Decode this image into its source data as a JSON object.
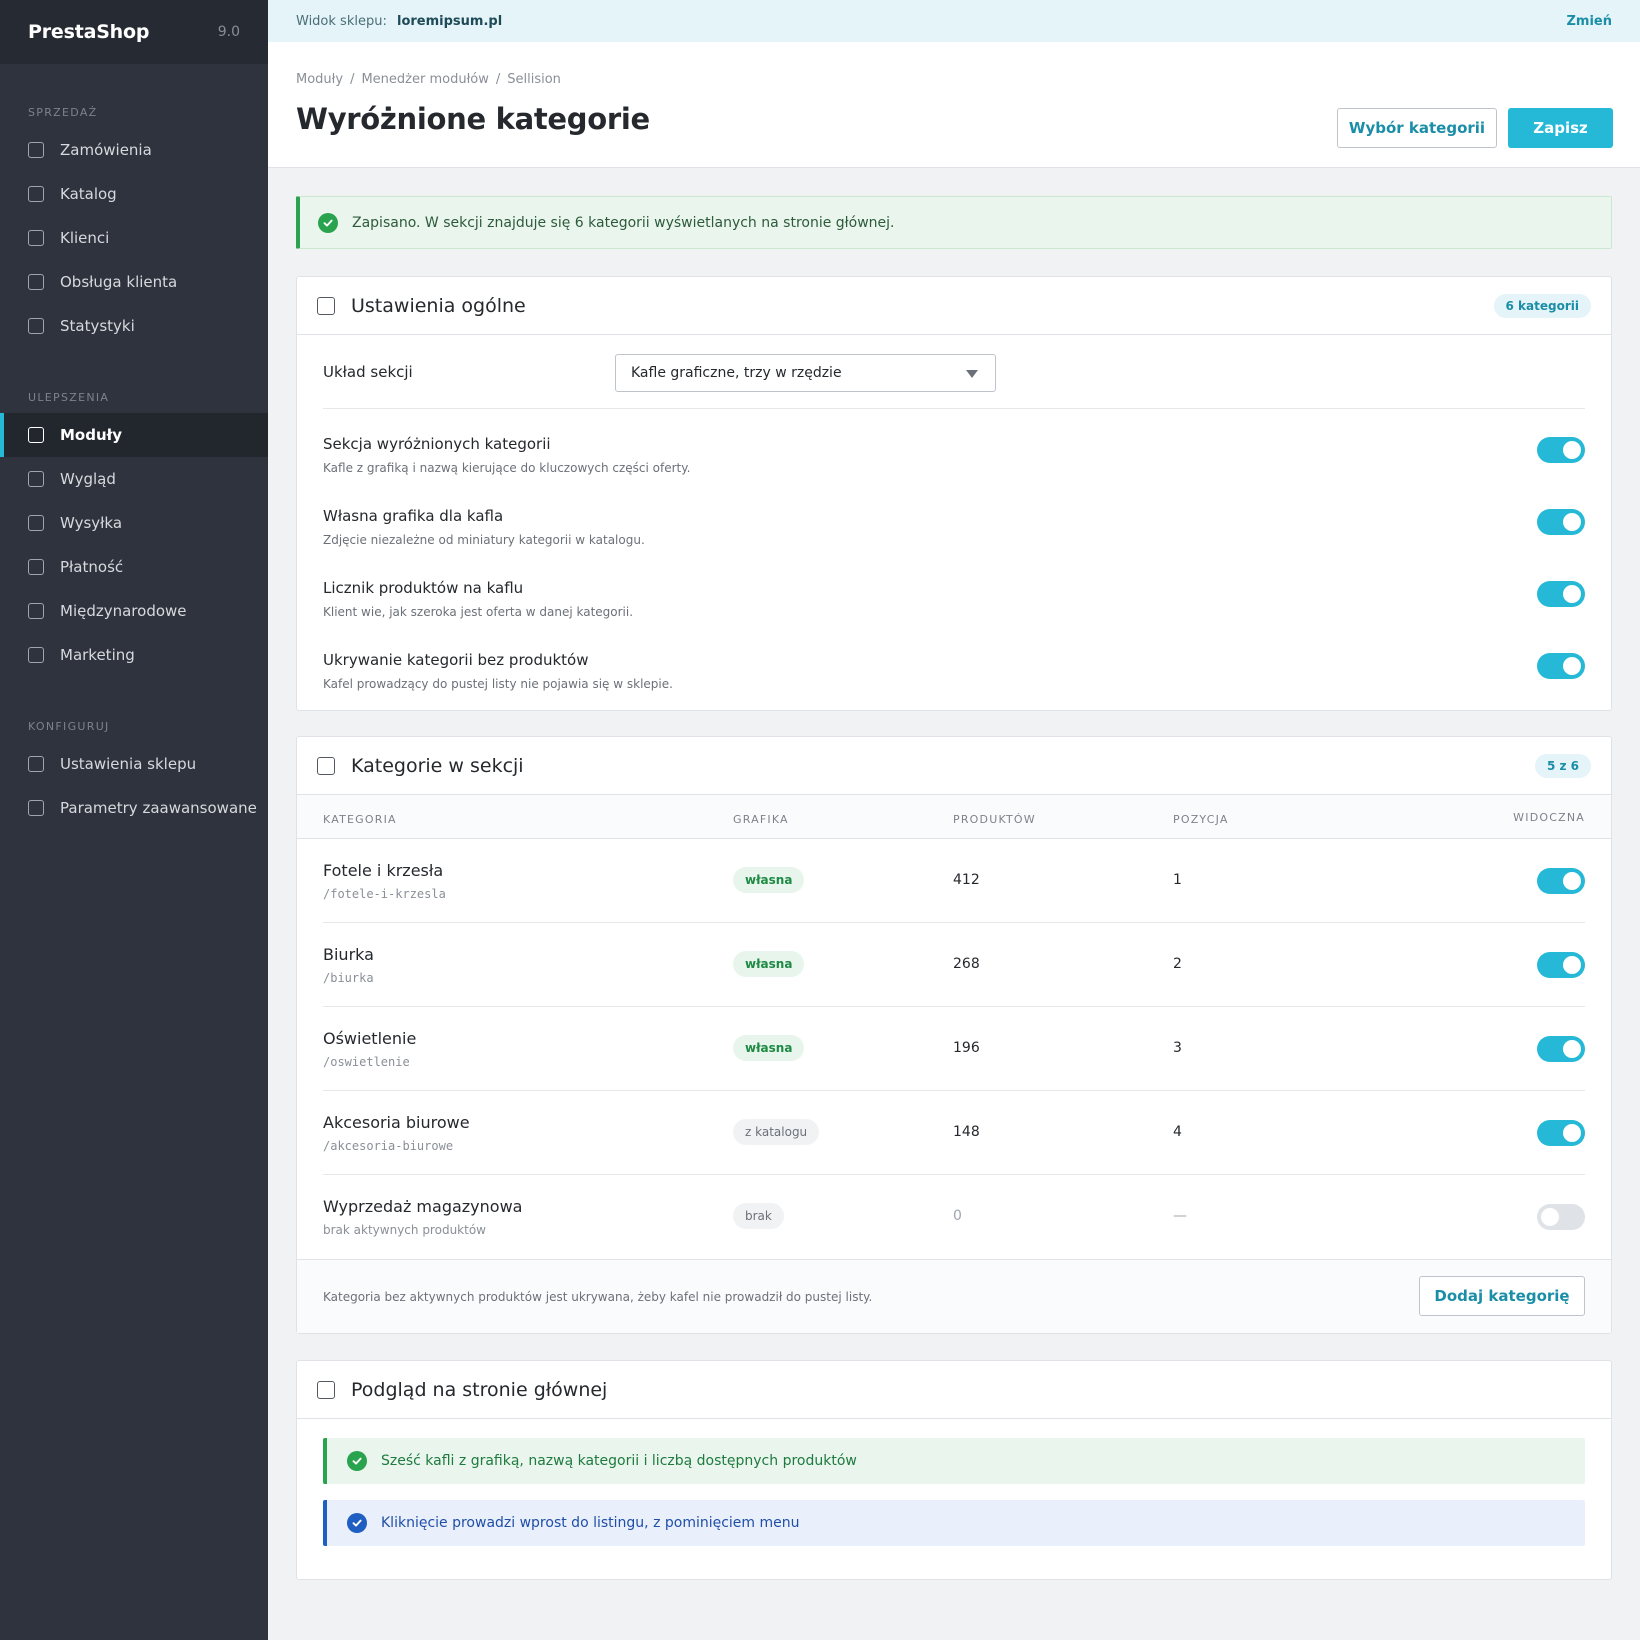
{
  "app": {
    "name": "PrestaShop",
    "version": "9.0"
  },
  "sidebar": {
    "sections": [
      {
        "title": "SPRZEDAŻ",
        "items": [
          {
            "label": "Zamówienia"
          },
          {
            "label": "Katalog"
          },
          {
            "label": "Klienci"
          },
          {
            "label": "Obsługa klienta"
          },
          {
            "label": "Statystyki"
          }
        ]
      },
      {
        "title": "ULEPSZENIA",
        "items": [
          {
            "label": "Moduły",
            "active": true
          },
          {
            "label": "Wygląd"
          },
          {
            "label": "Wysyłka"
          },
          {
            "label": "Płatność"
          },
          {
            "label": "Międzynarodowe"
          },
          {
            "label": "Marketing"
          }
        ]
      },
      {
        "title": "KONFIGURUJ",
        "items": [
          {
            "label": "Ustawienia sklepu"
          },
          {
            "label": "Parametry zaawansowane"
          }
        ]
      }
    ]
  },
  "topbar": {
    "label": "Widok sklepu:",
    "store": "loremipsum.pl",
    "change": "Zmień"
  },
  "header": {
    "breadcrumb": [
      "Moduły",
      "Menedżer modułów",
      "Sellision"
    ],
    "title": "Wyróżnione kategorie",
    "btn_categories": "Wybór kategorii",
    "btn_save": "Zapisz"
  },
  "alert": {
    "text": "Zapisano. W sekcji znajduje się 6 kategorii wyświetlanych na stronie głównej."
  },
  "general": {
    "title": "Ustawienia ogólne",
    "badge": "6 kategorii",
    "layout_label": "Układ sekcji",
    "layout_value": "Kafle graficzne, trzy w rzędzie",
    "settings": [
      {
        "title": "Sekcja wyróżnionych kategorii",
        "desc": "Kafle z grafiką i nazwą kierujące do kluczowych części oferty.",
        "on": true
      },
      {
        "title": "Własna grafika dla kafla",
        "desc": "Zdjęcie niezależne od miniatury kategorii w katalogu.",
        "on": true
      },
      {
        "title": "Licznik produktów na kaflu",
        "desc": "Klient wie, jak szeroka jest oferta w danej kategorii.",
        "on": true
      },
      {
        "title": "Ukrywanie kategorii bez produktów",
        "desc": "Kafel prowadzący do pustej listy nie pojawia się w sklepie.",
        "on": true
      }
    ]
  },
  "categories": {
    "title": "Kategorie w sekcji",
    "badge": "5 z 6",
    "columns": {
      "category": "KATEGORIA",
      "graphic": "GRAFIKA",
      "products": "PRODUKTÓW",
      "position": "POZYCJA",
      "visible": "WIDOCZNA"
    },
    "rows": [
      {
        "name": "Fotele i krzesła",
        "slug": "/fotele-i-krzesla",
        "graphic": "własna",
        "products": "412",
        "position": "1",
        "visible": true
      },
      {
        "name": "Biurka",
        "slug": "/biurka",
        "graphic": "własna",
        "products": "268",
        "position": "2",
        "visible": true
      },
      {
        "name": "Oświetlenie",
        "slug": "/oswietlenie",
        "graphic": "własna",
        "products": "196",
        "position": "3",
        "visible": true
      },
      {
        "name": "Akcesoria biurowe",
        "slug": "/akcesoria-biurowe",
        "graphic": "z katalogu",
        "products": "148",
        "position": "4",
        "visible": true
      },
      {
        "name": "Wyprzedaż magazynowa",
        "slug": "brak aktywnych produktów",
        "graphic": "brak",
        "products": "0",
        "position": "—",
        "visible": false
      }
    ],
    "footer_note": "Kategoria bez aktywnych produktów jest ukrywana, żeby kafel nie prowadził do pustej listy.",
    "btn_add": "Dodaj kategorię"
  },
  "preview": {
    "title": "Podgląd na stronie głównej",
    "callouts": [
      "Sześć kafli z grafiką, nazwą kategorii i liczbą dostępnych produktów",
      "Kliknięcie prowadzi wprost do listingu, z pominięciem menu"
    ]
  },
  "colors": {
    "accent": "#25b9d7",
    "success": "#29a34e",
    "info": "#1f5fc2",
    "sidebar": "#2e333d"
  }
}
